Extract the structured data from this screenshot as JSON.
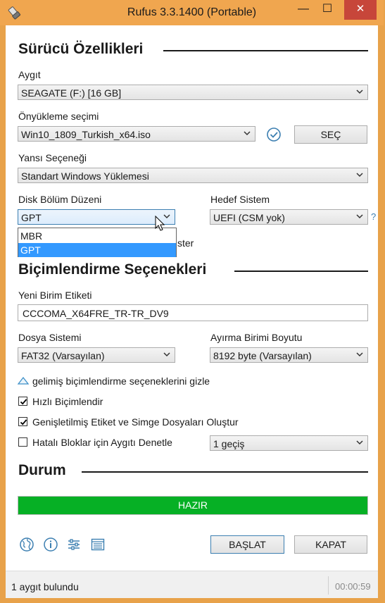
{
  "window": {
    "title": "Rufus 3.3.1400 (Portable)",
    "close_glyph": "✕",
    "minimize_glyph": "—",
    "maximize_glyph": "☐"
  },
  "drive": {
    "section_title": "Sürücü Özellikleri",
    "device_label": "Aygıt",
    "device_value": "SEAGATE (F:) [16 GB]",
    "boot_label": "Önyükleme seçimi",
    "boot_value": "Win10_1809_Turkish_x64.iso",
    "select_button": "SEÇ",
    "image_option_label": "Yansı Seçeneği",
    "image_option_value": "Standart Windows Yüklemesi",
    "partition_label": "Disk Bölüm Düzeni",
    "partition_value": "GPT",
    "partition_options": [
      "MBR",
      "GPT"
    ],
    "partition_selected_option": "GPT",
    "target_label": "Hedef Sistem",
    "target_value": "UEFI (CSM yok)",
    "help_glyph": "?",
    "hidden_fragment": "ster"
  },
  "format": {
    "section_title": "Biçimlendirme Seçenekleri",
    "volume_label": "Yeni Birim Etiketi",
    "volume_value": "CCCOMA_X64FRE_TR-TR_DV9",
    "fs_label": "Dosya Sistemi",
    "fs_value": "FAT32 (Varsayılan)",
    "cluster_label": "Ayırma Birimi Boyutu",
    "cluster_value": "8192 byte (Varsayılan)",
    "advanced_toggle": "gelimiş biçimlendirme seçeneklerini gizle",
    "quick_format": {
      "label": "Hızlı Biçimlendir",
      "checked": true
    },
    "extended_label": {
      "label": "Genişletilmiş Etiket ve Simge Dosyaları Oluştur",
      "checked": true
    },
    "bad_blocks": {
      "label": "Hatalı Bloklar için Aygıtı Denetle",
      "checked": false
    },
    "passes_value": "1 geçiş"
  },
  "status": {
    "section_title": "Durum",
    "progress_text": "HAZIR",
    "progress_fraction": 1.0,
    "progress_color": "#06b025",
    "icons": [
      "globe-icon",
      "info-icon",
      "settings-sliders-icon",
      "log-icon"
    ],
    "start_button": "BAŞLAT",
    "close_button": "KAPAT"
  },
  "statusbar": {
    "text": "1 aygıt bulundu",
    "timer": "00:00:59"
  },
  "colors": {
    "title_bar": "#f0a64f",
    "accent": "#3c7fb1",
    "selection": "#3399ff"
  }
}
